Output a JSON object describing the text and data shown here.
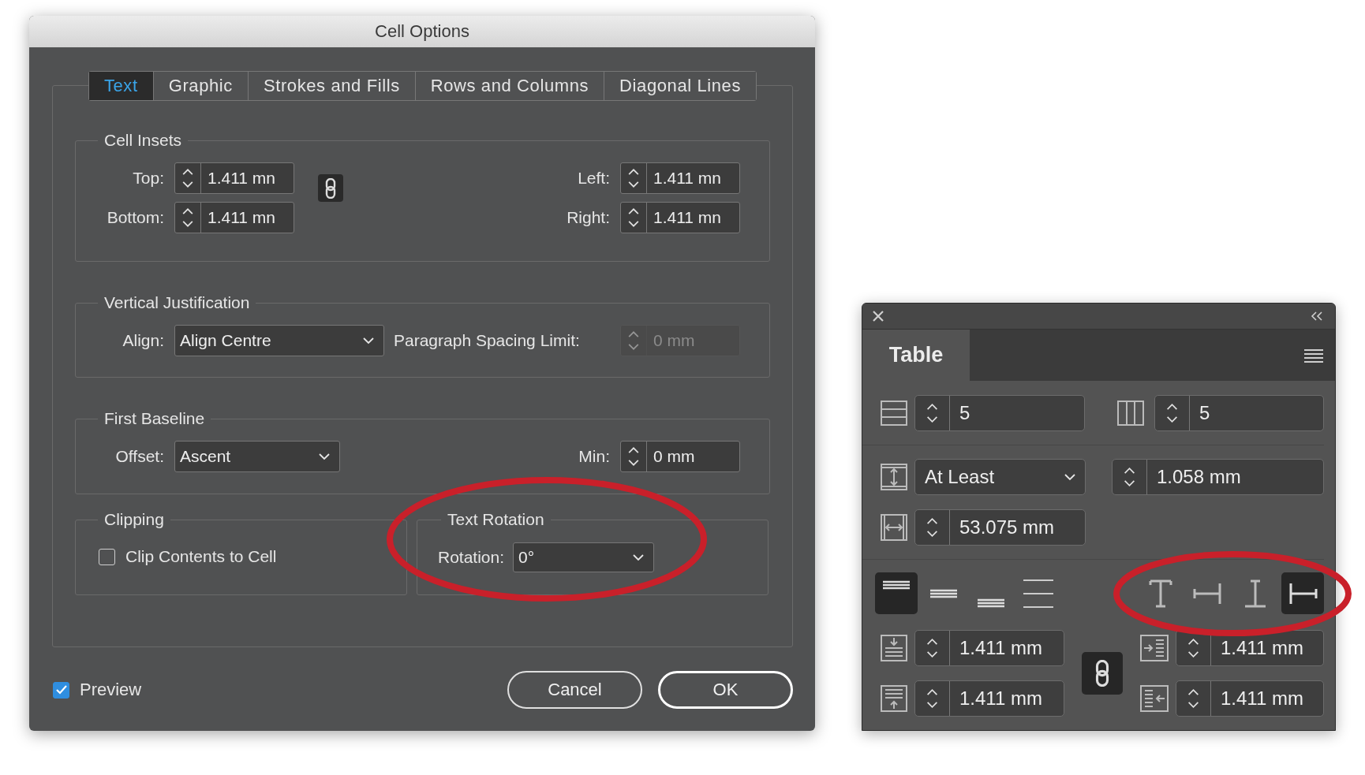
{
  "dialog": {
    "title": "Cell Options",
    "tabs": [
      {
        "label": "Text",
        "selected": true
      },
      {
        "label": "Graphic",
        "selected": false
      },
      {
        "label": "Strokes and Fills",
        "selected": false
      },
      {
        "label": "Rows and Columns",
        "selected": false
      },
      {
        "label": "Diagonal Lines",
        "selected": false
      }
    ],
    "cell_insets": {
      "title": "Cell Insets",
      "linked": true,
      "fields": [
        {
          "label": "Top:",
          "value": "1.411 mn"
        },
        {
          "label": "Left:",
          "value": "1.411 mn"
        },
        {
          "label": "Bottom:",
          "value": "1.411 mn"
        },
        {
          "label": "Right:",
          "value": "1.411 mn"
        }
      ]
    },
    "vertical_justification": {
      "title": "Vertical Justification",
      "align_label": "Align:",
      "align_value": "Align Centre",
      "spacing_label": "Paragraph Spacing Limit:",
      "spacing_value": "0 mm",
      "spacing_disabled": true
    },
    "first_baseline": {
      "title": "First Baseline",
      "offset_label": "Offset:",
      "offset_value": "Ascent",
      "min_label": "Min:",
      "min_value": "0 mm"
    },
    "clipping": {
      "title": "Clipping",
      "label": "Clip Contents to Cell",
      "checked": false
    },
    "text_rotation": {
      "title": "Text Rotation",
      "label": "Rotation:",
      "value": "0°",
      "highlighted": true
    },
    "preview": {
      "label": "Preview",
      "checked": true
    },
    "buttons": [
      {
        "label": "Cancel",
        "kind": "secondary"
      },
      {
        "label": "OK",
        "kind": "default"
      }
    ]
  },
  "panel": {
    "title": "Table",
    "rows": {
      "value": "5"
    },
    "columns": {
      "value": "5"
    },
    "row_height": {
      "mode": "At Least",
      "value": "1.058 mm"
    },
    "column_width": {
      "value": "53.075 mm"
    },
    "vertical_align": [
      {
        "kind": "top",
        "selected": true
      },
      {
        "kind": "center",
        "selected": false
      },
      {
        "kind": "bottom",
        "selected": false
      },
      {
        "kind": "justify",
        "selected": false
      }
    ],
    "rotation": {
      "highlighted": true,
      "options": [
        {
          "kind": "r0",
          "selected": false
        },
        {
          "kind": "r90",
          "selected": false
        },
        {
          "kind": "r180",
          "selected": false
        },
        {
          "kind": "r270",
          "selected": true
        }
      ]
    },
    "insets": {
      "top": "1.411 mm",
      "bottom": "1.411 mm",
      "left": "1.411 mm",
      "right": "1.411 mm",
      "linked": true
    }
  }
}
